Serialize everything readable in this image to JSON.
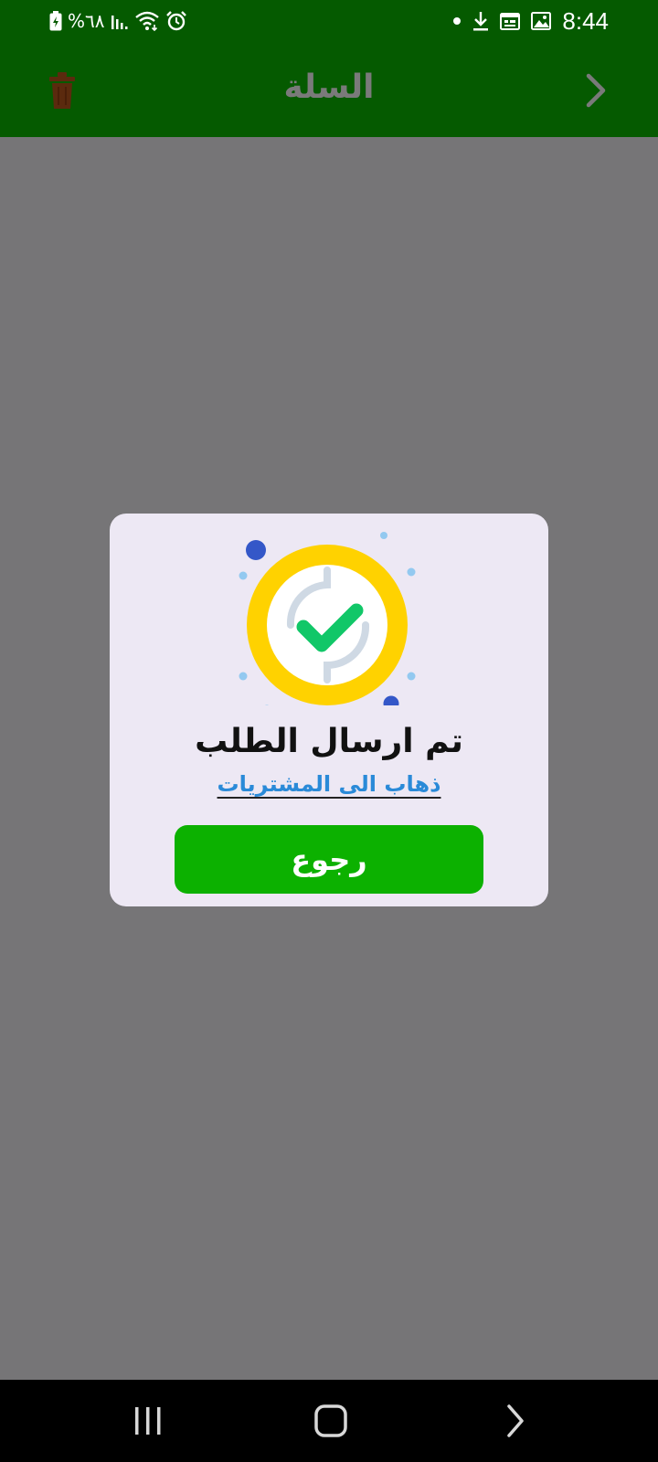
{
  "status_bar": {
    "battery_percent": "%٦٨",
    "time": "8:44",
    "icons_left": [
      "battery-charging-icon",
      "signal-icon",
      "wifi-icon",
      "alarm-icon"
    ],
    "icons_right": [
      "notification-dot-icon",
      "download-icon",
      "calendar-icon",
      "image-icon"
    ]
  },
  "app_bar": {
    "title": "السلة",
    "trash_icon": "trash-icon",
    "back_icon": "chevron-right-icon"
  },
  "dialog": {
    "icon": "success-check-icon",
    "title": "تم ارسال الطلب",
    "link": "ذهاب الى المشتريات",
    "button": "رجوع"
  },
  "nav_bar": {
    "icons": [
      "recents-icon",
      "home-icon",
      "back-icon"
    ]
  },
  "colors": {
    "app_bar": "#055a00",
    "overlay": "#767577",
    "dialog_bg": "#ede8f4",
    "button": "#0cb100",
    "link": "#2a8ad8",
    "check_ring": "#ffd200",
    "check_mark": "#11c768"
  }
}
